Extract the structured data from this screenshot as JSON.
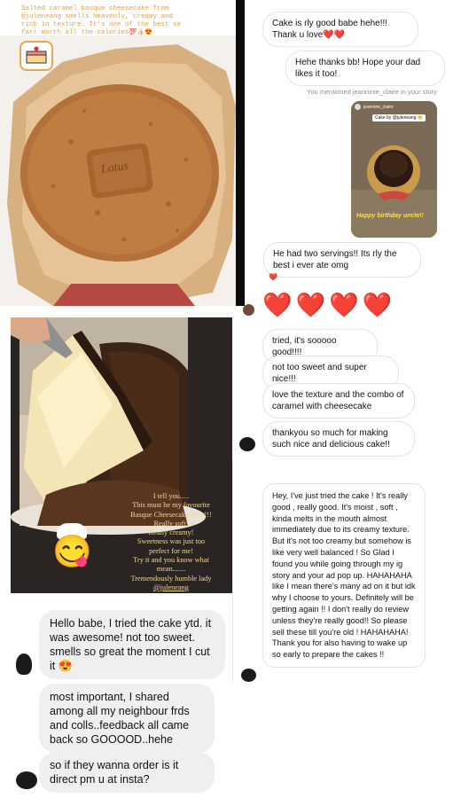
{
  "top_story": {
    "caption": "Salted caramel basque cheesecake from @juleneang smells heavenly, creamy and rich in texture. It's one of the best so far! Worth all the calories",
    "hundred_emoji": "💯",
    "emojis": "👍🏻😍",
    "cookie_text": "Lotus"
  },
  "right_top_chat": {
    "msg1": "Cake is rly good babe hehe!!! Thank u love",
    "msg1_hearts": "❤️❤️",
    "msg2": "Hehe thanks bb! Hope your dad likes it too!",
    "mention_note": "You mentioned jeanninie_claire in your story",
    "story_card": {
      "header_user": "jeannine_claire",
      "tag": "Cake by @juleneang 👏",
      "caption": "Happy birthday uncle!!"
    },
    "msg3": "He had two servings!! Its rly the best i ever ate omg",
    "msg3_heart": "❤️",
    "big_hearts": [
      "❤️",
      "❤️",
      "❤️",
      "❤️"
    ],
    "msg4": "tried, it's sooooo good!!!!",
    "msg5": "not too sweet and super nice!!!",
    "msg6": "love the texture and the combo of caramel with cheesecake",
    "msg7": "thankyou so much for making such nice and delicious cake!!"
  },
  "mid_story": {
    "text_lines": [
      "I tell you.....",
      "This must be my favourite",
      "Basque Cheesecake Ever!!!",
      "Really soft!",
      "Really creamy!",
      "Sweetness was just too",
      "perfect for me!",
      "Try it and you know what",
      "mean.......",
      "Tremendously humble lady",
      "@juleneang"
    ],
    "emoji": "😋"
  },
  "long_review": {
    "text": "Hey, I've just tried the cake ! It's really good , really good. It's moist , soft , kinda melts in the mouth almost immediately due to its creamy texture. But it's not too creamy but somehow is like very well balanced ! So Glad I found you while going through my ig story and your ad pop up. HAHAHAHA like I mean there's many ad on it but idk why I choose to yours. Definitely will be getting again !! I don't really do review unless they're really good!! So please sell these till you're old ! HAHAHAHA! Thank you for also having to wake up so early to prepare the cakes !!"
  },
  "bottom_chat": {
    "msg1": "Hello babe, I tried the cake ytd. it was awesome! not too sweet. smells so great the moment I cut it",
    "msg1_emoji": "😍",
    "msg2": "most important,  I shared among all my neighbour frds and colls..feedback all came back so GOOOOD..hehe",
    "msg3": "so if they wanna order is it direct pm u at insta?"
  },
  "colors": {
    "heart_red": "#e0242b",
    "story_text_orange": "#e2a24a",
    "bubble_grey": "#efefef",
    "dark_panel": "#23201e"
  }
}
